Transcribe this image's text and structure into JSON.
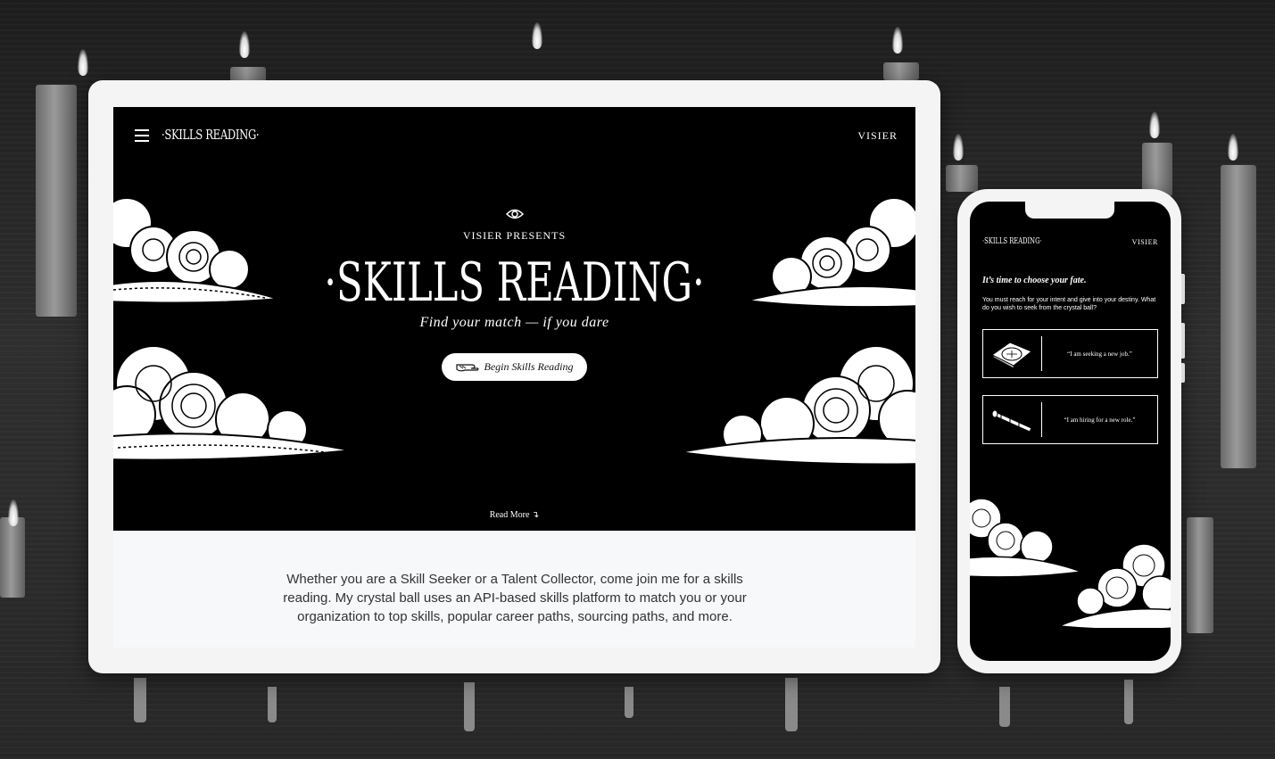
{
  "tablet": {
    "brand": "·SKILLS READING·",
    "visier": "VISIER",
    "hero": {
      "presents": "VISIER PRESENTS",
      "title": "·SKILLS READING·",
      "tagline": "Find your match — if you dare",
      "cta_label": "Begin Skills Reading",
      "read_more": "Read More ↴"
    },
    "intro": "Whether you are a Skill Seeker or a Talent Collector, come join me for a skills reading. My crystal ball uses an API-based skills platform to match you or your organization to top skills, popular career paths, sourcing paths, and more."
  },
  "phone": {
    "brand": "·SKILLS READING·",
    "visier": "VISIER",
    "heading": "It’s time to choose your fate.",
    "subtext": "You must reach for your intent and give into your destiny. What do you wish to seek from the crystal ball?",
    "options": [
      {
        "label": "“I am seeking a new job.”",
        "icon": "compass-icon"
      },
      {
        "label": "“I am hiring for a new role.”",
        "icon": "spyglass-icon"
      }
    ]
  },
  "icons": [
    "hamburger-icon",
    "eye-icon",
    "pointing-hand-icon",
    "compass-icon",
    "spyglass-icon",
    "cloud-icon"
  ],
  "colors": {
    "hero_bg": "#000000",
    "device_frame": "#f4f4f4",
    "page_bg": "#262626",
    "text_light": "#ffffff"
  }
}
